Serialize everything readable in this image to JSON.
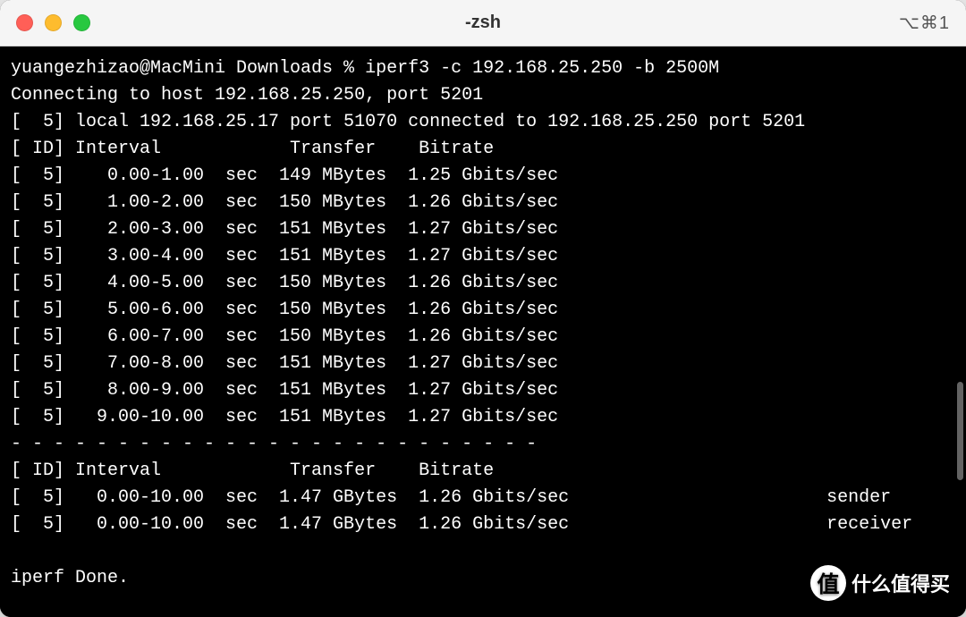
{
  "titlebar": {
    "title": "-zsh",
    "shortcut": "⌥⌘1"
  },
  "prompt": {
    "user": "yuangezhizao",
    "host": "MacMini",
    "cwd": "Downloads",
    "symbol": "%",
    "command": "iperf3 -c 192.168.25.250 -b 2500M"
  },
  "connecting_line": "Connecting to host 192.168.25.250, port 5201",
  "local_line": "[  5] local 192.168.25.17 port 51070 connected to 192.168.25.250 port 5201",
  "header": {
    "id": "[ ID]",
    "interval": "Interval",
    "transfer": "Transfer",
    "bitrate": "Bitrate"
  },
  "rows": [
    {
      "id": "[  5]",
      "interval": "0.00-1.00",
      "unit": "sec",
      "transfer": "149 MBytes",
      "bitrate": "1.25 Gbits/sec"
    },
    {
      "id": "[  5]",
      "interval": "1.00-2.00",
      "unit": "sec",
      "transfer": "150 MBytes",
      "bitrate": "1.26 Gbits/sec"
    },
    {
      "id": "[  5]",
      "interval": "2.00-3.00",
      "unit": "sec",
      "transfer": "151 MBytes",
      "bitrate": "1.27 Gbits/sec"
    },
    {
      "id": "[  5]",
      "interval": "3.00-4.00",
      "unit": "sec",
      "transfer": "151 MBytes",
      "bitrate": "1.27 Gbits/sec"
    },
    {
      "id": "[  5]",
      "interval": "4.00-5.00",
      "unit": "sec",
      "transfer": "150 MBytes",
      "bitrate": "1.26 Gbits/sec"
    },
    {
      "id": "[  5]",
      "interval": "5.00-6.00",
      "unit": "sec",
      "transfer": "150 MBytes",
      "bitrate": "1.26 Gbits/sec"
    },
    {
      "id": "[  5]",
      "interval": "6.00-7.00",
      "unit": "sec",
      "transfer": "150 MBytes",
      "bitrate": "1.26 Gbits/sec"
    },
    {
      "id": "[  5]",
      "interval": "7.00-8.00",
      "unit": "sec",
      "transfer": "151 MBytes",
      "bitrate": "1.27 Gbits/sec"
    },
    {
      "id": "[  5]",
      "interval": "8.00-9.00",
      "unit": "sec",
      "transfer": "151 MBytes",
      "bitrate": "1.27 Gbits/sec"
    },
    {
      "id": "[  5]",
      "interval": "9.00-10.00",
      "unit": "sec",
      "transfer": "151 MBytes",
      "bitrate": "1.27 Gbits/sec"
    }
  ],
  "separator": "- - - - - - - - - - - - - - - - - - - - - - - - -",
  "summary": [
    {
      "id": "[  5]",
      "interval": "0.00-10.00",
      "unit": "sec",
      "transfer": "1.47 GBytes",
      "bitrate": "1.26 Gbits/sec",
      "role": "sender"
    },
    {
      "id": "[  5]",
      "interval": "0.00-10.00",
      "unit": "sec",
      "transfer": "1.47 GBytes",
      "bitrate": "1.26 Gbits/sec",
      "role": "receiver"
    }
  ],
  "done_line": "iperf Done.",
  "watermark": {
    "icon_text": "值",
    "text": "什么值得买"
  }
}
